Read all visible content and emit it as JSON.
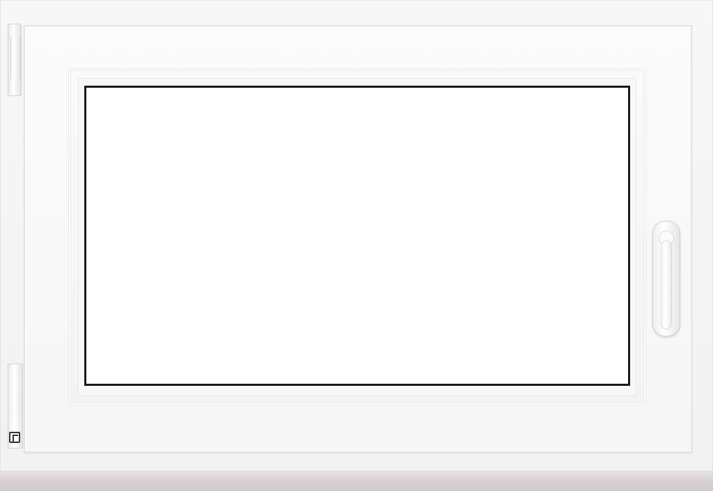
{
  "image": {
    "subject": "",
    "colors": {
      "frame": "#f5f5f5",
      "glass_border": "#1a1a1a",
      "glass": "#ffffff",
      "sill": "#d8d2d3"
    },
    "icons": [
      "hinge-icon",
      "window-handle-icon"
    ]
  }
}
